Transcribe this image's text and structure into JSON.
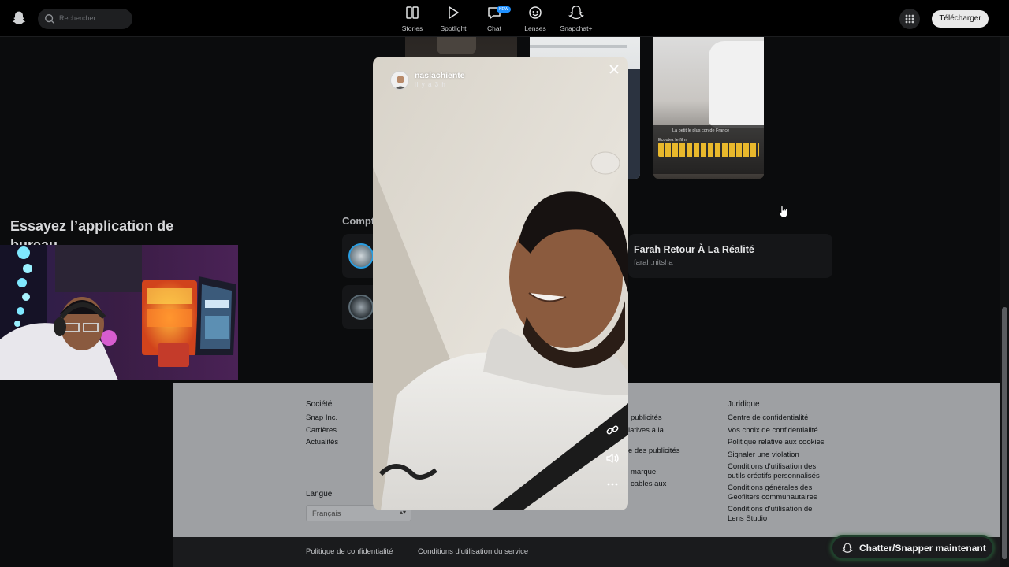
{
  "topbar": {
    "search_placeholder": "Rechercher",
    "nav": [
      {
        "label": "Stories",
        "icon": "stories-icon"
      },
      {
        "label": "Spotlight",
        "icon": "spotlight-play-icon"
      },
      {
        "label": "Chat",
        "icon": "chat-icon",
        "badge": "NEW"
      },
      {
        "label": "Lenses",
        "icon": "lenses-icon"
      },
      {
        "label": "Snapchat+",
        "icon": "snapchat-plus-icon"
      }
    ],
    "download_label": "Télécharger"
  },
  "sidebar": {
    "try_app": "Essayez l’application de bureau"
  },
  "thumb_caption": {
    "line1": "La petit le plus con de France",
    "line2": "Ecoutez le film"
  },
  "accounts": {
    "heading": "Compt",
    "featured_name": "Farah Retour À La Réalité",
    "featured_user": "farah.nitsha"
  },
  "story": {
    "username": "naslachiente",
    "time": "il y a 3 h"
  },
  "footer": {
    "company_head": "Société",
    "company_links": [
      "Snap Inc.",
      "Carrières",
      "Actualités"
    ],
    "ads_partial": [
      "publicités",
      "latives à la",
      "e des publicités",
      "marque",
      "cables aux"
    ],
    "legal_head": "Juridique",
    "legal_links": [
      "Centre de confidentialité",
      "Vos choix de confidentialité",
      "Politique relative aux cookies",
      "Signaler une violation",
      "Conditions d'utilisation des outils créatifs personnalisés",
      "Conditions générales des Geofilters communautaires",
      "Conditions d'utilisation de Lens Studio"
    ],
    "language_head": "Langue",
    "language_value": "Français",
    "bottom_links": [
      "Politique de confidentialité",
      "Conditions d'utilisation du service"
    ]
  },
  "chat_cta": "Chatter/Snapper maintenant",
  "colors": {
    "background": "#0b0c0d",
    "footer": "#9ea0a3",
    "cta_glow": "#2e6b3a"
  }
}
